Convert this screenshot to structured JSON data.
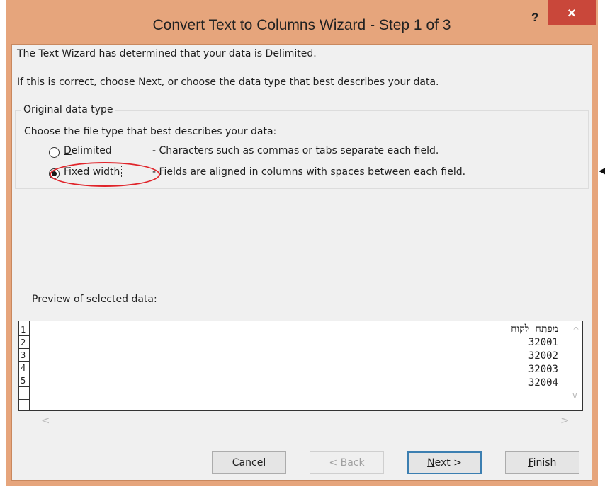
{
  "window": {
    "title": "Convert Text to Columns Wizard - Step 1 of 3",
    "help_glyph": "?",
    "close_glyph": "×"
  },
  "intro": {
    "line1": "The Text Wizard has determined that your data is Delimited.",
    "line2": "If this is correct, choose Next, or choose the data type that best describes your data."
  },
  "group": {
    "legend": "Original data type",
    "prompt": "Choose the file type that best describes your data:",
    "options": [
      {
        "label": "Delimited",
        "description": "- Characters such as commas or tabs separate each field.",
        "selected": false
      },
      {
        "label": "Fixed width",
        "description": "- Fields are aligned in columns with spaces between each field.",
        "selected": true
      }
    ]
  },
  "preview": {
    "label": "Preview of selected data:",
    "rows": [
      {
        "num": "1",
        "value": "מפתח לקוח"
      },
      {
        "num": "2",
        "value": "32001"
      },
      {
        "num": "3",
        "value": "32002"
      },
      {
        "num": "4",
        "value": "32003"
      },
      {
        "num": "5",
        "value": "32004"
      }
    ]
  },
  "buttons": {
    "cancel": "Cancel",
    "back": "< Back",
    "next": "Next >",
    "finish": "Finish"
  },
  "colors": {
    "title_bar": "#e6a57c",
    "close_button": "#c9473a",
    "annotation": "#e0242a"
  }
}
